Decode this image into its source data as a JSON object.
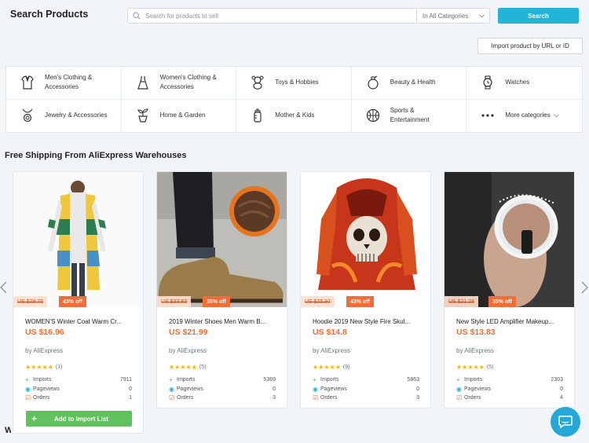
{
  "header": {
    "title": "Search Products",
    "search_placeholder": "Search for products to sell",
    "category_select": "In All Categories",
    "search_button": "Search",
    "import_button": "Import product by URL or ID"
  },
  "categories": [
    {
      "label": "Men's Clothing & Accessories",
      "icon": "shirt-icon"
    },
    {
      "label": "Women's Clothing & Accessories",
      "icon": "dress-icon"
    },
    {
      "label": "Toys & Hobbies",
      "icon": "teddy-bear-icon"
    },
    {
      "label": "Beauty & Health",
      "icon": "perfume-icon"
    },
    {
      "label": "Watches",
      "icon": "watch-icon"
    },
    {
      "label": "Jewelry & Accessories",
      "icon": "necklace-icon"
    },
    {
      "label": "Home & Garden",
      "icon": "plant-pot-icon"
    },
    {
      "label": "Mother & Kids",
      "icon": "baby-bottle-icon"
    },
    {
      "label": "Sports & Entertainment",
      "icon": "basketball-icon"
    },
    {
      "label": "More categories",
      "icon": "more-dots-icon"
    }
  ],
  "section_title": "Free Shipping From AliExpress Warehouses",
  "products": [
    {
      "name": "WOMEN'S Winter Coat Warm Cr...",
      "old_price": "US $29.76",
      "discount": "43% off",
      "price": "US $16.96",
      "seller": "by AliExpress",
      "rating_count": "(1)",
      "imports": "7911",
      "pageviews": "0",
      "orders": "1"
    },
    {
      "name": "2019 Winter Shoes Men Warm B...",
      "old_price": "US $33.83",
      "discount": "35% off",
      "price": "US $21.99",
      "seller": "by AliExpress",
      "rating_count": "(5)",
      "imports": "5369",
      "pageviews": "0",
      "orders": "3"
    },
    {
      "name": "Hoodie 2019 New Style Fire Skul...",
      "old_price": "US $25.97",
      "discount": "43% off",
      "price": "US $14.8",
      "seller": "by AliExpress",
      "rating_count": "(9)",
      "imports": "5863",
      "pageviews": "0",
      "orders": "3"
    },
    {
      "name": "New Style LED Amplifier Makeup...",
      "old_price": "US $21.28",
      "discount": "35% off",
      "price": "US $13.83",
      "seller": "by AliExpress",
      "rating_count": "(5)",
      "imports": "2303",
      "pageviews": "0",
      "orders": "4"
    }
  ],
  "stat_labels": {
    "imports": "Imports",
    "pageviews": "Pageviews",
    "orders": "Orders"
  },
  "stars": "★★★★★",
  "add_button": "Add to Import List",
  "next_section_initial": "W",
  "colors": {
    "accent": "#23b5d8",
    "price": "#f26d38",
    "add_button": "#5fc25c"
  }
}
